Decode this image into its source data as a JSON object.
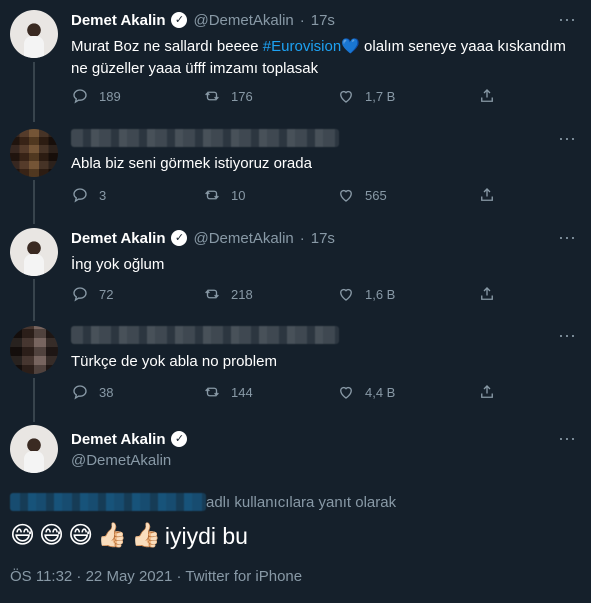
{
  "tweets": [
    {
      "name": "Demet Akalin",
      "handle": "@DemetAkalin",
      "dot": "·",
      "time": "17s",
      "text_1": "Murat Boz ne sallardı beeee",
      "hashtag": "#Eurovision",
      "heart_emoji": "💙",
      "text_2": "olalım seneye yaaa kıskandım ne güzeller yaaa üfff imzamı toplasak",
      "replies": "189",
      "retweets": "176",
      "likes": "1,7 B"
    },
    {
      "text": "Abla biz seni görmek istiyoruz orada",
      "replies": "3",
      "retweets": "10",
      "likes": "565"
    },
    {
      "name": "Demet Akalin",
      "handle": "@DemetAkalin",
      "dot": "·",
      "time": "17s",
      "text": "İng yok oğlum",
      "replies": "72",
      "retweets": "218",
      "likes": "1,6 B"
    },
    {
      "text": "Türkçe de yok abla no problem",
      "replies": "38",
      "retweets": "144",
      "likes": "4,4 B"
    }
  ],
  "main": {
    "name": "Demet Akalin",
    "handle": "@DemetAkalin",
    "reply_note": "adlı kullanıcılara yanıt olarak",
    "emojis": [
      "😅",
      "😅",
      "😅",
      "👍🏻",
      "👍🏻"
    ],
    "text": "iyiydi bu",
    "meta": "ÖS 11:32 · 22 May 2021 · Twitter for iPhone"
  },
  "icons": {
    "more": "more-icon",
    "reply": "reply-icon",
    "retweet": "retweet-icon",
    "like": "like-icon",
    "share": "share-icon",
    "verified": "verified-icon"
  },
  "colors": {
    "background": "#15202b",
    "text": "#ffffff",
    "secondary": "#8899a6",
    "accent": "#1da1f2",
    "separator": "#38444d"
  },
  "glyphs": {
    "verified_check": "✓",
    "more_dots": "···"
  }
}
